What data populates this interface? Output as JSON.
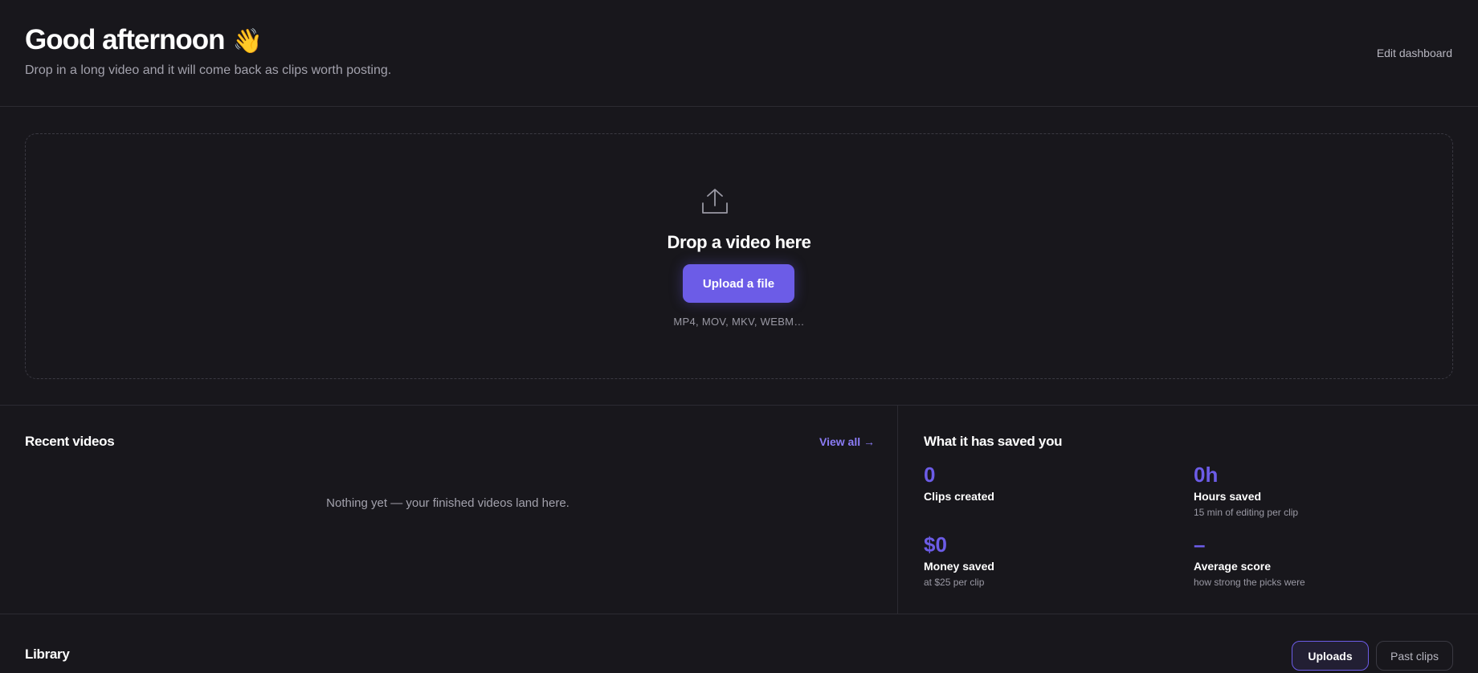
{
  "header": {
    "greeting": "Good afternoon",
    "greeting_emoji": "👋",
    "subtitle": "Drop in a long video and it will come back as clips worth posting.",
    "edit_dashboard_label": "Edit dashboard"
  },
  "dropzone": {
    "icon": "upload-icon",
    "title": "Drop a video here",
    "button_label": "Upload a file",
    "formats": "MP4, MOV, MKV, WEBM…"
  },
  "recent_videos": {
    "title": "Recent videos",
    "view_all_label": "View all →",
    "empty_message": "Nothing yet — your finished videos land here."
  },
  "savings": {
    "title": "What it has saved you",
    "stats": [
      {
        "value": "0",
        "label": "Clips created",
        "note": ""
      },
      {
        "value": "0h",
        "label": "Hours saved",
        "note": "15 min of editing per clip"
      },
      {
        "value": "$0",
        "label": "Money saved",
        "note": "at $25 per clip"
      },
      {
        "value": "–",
        "label": "Average score",
        "note": "how strong the picks were"
      }
    ]
  },
  "library": {
    "title": "Library",
    "tabs": [
      {
        "label": "Uploads",
        "active": true
      },
      {
        "label": "Past clips",
        "active": false
      }
    ]
  },
  "colors": {
    "background": "#18171c",
    "accent": "#6c5ce7",
    "accent_link": "#8b7cf6",
    "muted_text": "#a3a2ad",
    "divider": "#2c2b32"
  }
}
